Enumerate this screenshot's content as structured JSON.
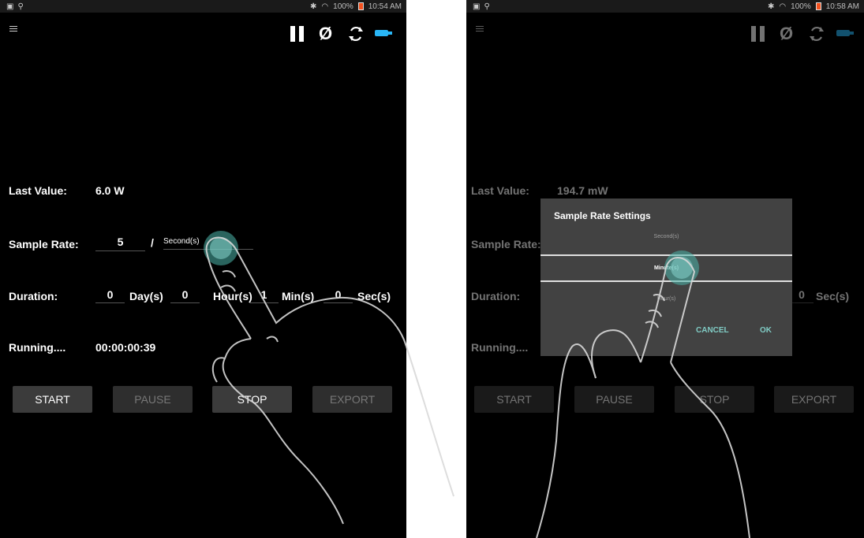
{
  "left": {
    "status": {
      "battery": "100%",
      "time": "10:54 AM"
    },
    "last_value": {
      "label": "Last Value:",
      "value": "6.0 W"
    },
    "sample_rate": {
      "label": "Sample Rate:",
      "value": "5",
      "separator": "/",
      "unit": "Second(s)"
    },
    "duration": {
      "label": "Duration:",
      "days": "0",
      "days_unit": "Day(s)",
      "hours": "0",
      "hours_unit": "Hour(s)",
      "mins": "1",
      "mins_unit": "Min(s)",
      "secs": "0",
      "secs_unit": "Sec(s)"
    },
    "running": {
      "label": "Running....",
      "value": "00:00:00:39"
    },
    "buttons": {
      "start": "START",
      "pause": "PAUSE",
      "stop": "STOP",
      "export": "EXPORT"
    }
  },
  "right": {
    "status": {
      "battery": "100%",
      "time": "10:58 AM"
    },
    "last_value": {
      "label": "Last Value:",
      "value": "194.7 mW"
    },
    "sample_rate": {
      "label": "Sample Rate:"
    },
    "duration": {
      "label": "Duration:",
      "secs": "0",
      "secs_unit": "Sec(s)"
    },
    "running": {
      "label": "Running...."
    },
    "buttons": {
      "start": "START",
      "pause": "PAUSE",
      "stop": "STOP",
      "export": "EXPORT"
    },
    "dialog": {
      "title": "Sample Rate Settings",
      "options": [
        "Second(s)",
        "Minute(s)",
        "Hour(s)"
      ],
      "selected": "Minute(s)",
      "cancel": "CANCEL",
      "ok": "OK"
    }
  },
  "colors": {
    "accent_teal": "#80cbc4",
    "plug_blue": "#29b6f6",
    "battery_red": "#f4511e"
  },
  "icons": [
    "menu-icon",
    "pause-icon",
    "null-icon",
    "refresh-icon",
    "plug-icon",
    "battery-icon",
    "wifi-icon",
    "bluetooth-icon"
  ]
}
